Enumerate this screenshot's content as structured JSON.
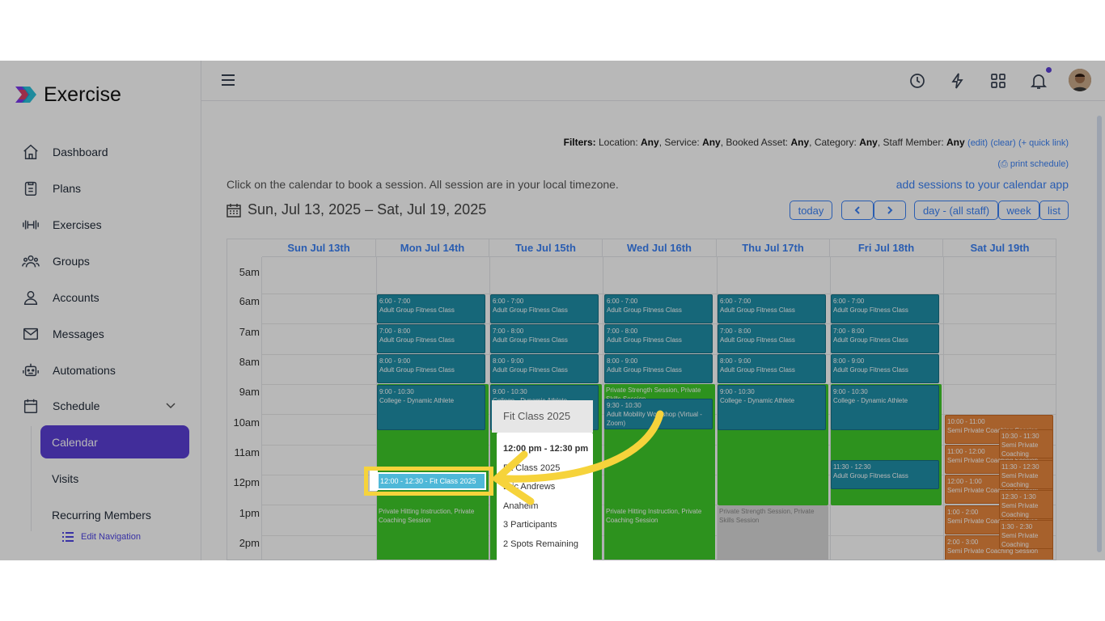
{
  "app": {
    "brand": "Exercise"
  },
  "sidebar": {
    "items": [
      {
        "label": "Dashboard",
        "icon": "home-icon"
      },
      {
        "label": "Plans",
        "icon": "clipboard-icon"
      },
      {
        "label": "Exercises",
        "icon": "dumbbell-icon"
      },
      {
        "label": "Groups",
        "icon": "users-icon"
      },
      {
        "label": "Accounts",
        "icon": "user-icon"
      },
      {
        "label": "Messages",
        "icon": "mail-icon"
      },
      {
        "label": "Automations",
        "icon": "robot-icon"
      },
      {
        "label": "Schedule",
        "icon": "calendar-icon"
      }
    ],
    "sub_items": [
      "Calendar",
      "Visits",
      "Recurring Members"
    ],
    "edit_navigation": "Edit Navigation"
  },
  "filters": {
    "label": "Filters:",
    "text_location": "Location:",
    "location": "Any",
    "text_service": "Service:",
    "service": "Any",
    "text_asset": "Booked Asset:",
    "asset": "Any",
    "text_category": "Category:",
    "category": "Any",
    "text_staff": "Staff Member:",
    "staff": "Any",
    "edit": "(edit)",
    "clear": "(clear)",
    "quick_link": "(+ quick link)",
    "print": "(⎙ print schedule)"
  },
  "calendar": {
    "hint": "Click on the calendar to book a session. All session are in your local timezone.",
    "add_sessions": "add sessions to your calendar app",
    "range": "Sun, Jul 13, 2025 – Sat, Jul 19, 2025",
    "buttons": {
      "today": "today",
      "day": "day - (all staff)",
      "week": "week",
      "list": "list"
    },
    "days": [
      "Sun Jul 13th",
      "Mon Jul 14th",
      "Tue Jul 15th",
      "Wed Jul 16th",
      "Thu Jul 17th",
      "Fri Jul 18th",
      "Sat Jul 19th"
    ],
    "hours": [
      "5am",
      "6am",
      "7am",
      "8am",
      "9am",
      "10am",
      "11am",
      "12pm",
      "1pm",
      "2pm"
    ],
    "events": {
      "t600": "6:00 - 7:00",
      "t700": "7:00 - 8:00",
      "t800": "8:00 - 9:00",
      "t900": "9:00 - 10:30",
      "agf": "Adult Group Fitness Class",
      "cda": "College - Dynamic Athlete",
      "t930": "9:30 - 10:30",
      "amw": "Adult Mobility Workshop (Virtual - Zoom)",
      "pss": "Private Strength Session, Private Skills Session",
      "t1130": "11:30 - 12:30",
      "phi": "Private Hitting Instruction, Private Coaching Session",
      "pss2": "Private Strength Session, Private Skills Session",
      "t1000": "10:00 - 11:00",
      "t1030": "10:30 - 11:30",
      "t1100": "11:00 - 12:00",
      "t1130b": "11:30 - 12:30",
      "t1200": "12:00 - 1:00",
      "t1230": "12:30 - 1:30",
      "t100": "1:00 - 2:00",
      "t130": "1:30 - 2:30",
      "t200": "2:00 - 3:00",
      "spc": "Semi Private Coaching Session",
      "spc2": "Semi Private Coaching"
    },
    "highlighted": "12:00 - 12:30 - Fit Class 2025",
    "popup": {
      "title": "Fit Class 2025",
      "time": "12:00 pm - 12:30 pm",
      "name": "Fit Class 2025",
      "coach": "Eric Andrews",
      "location": "Anaheim",
      "participants": "3 Participants",
      "spots": "2 Spots Remaining"
    }
  },
  "colors": {
    "accent": "#5b3fd6",
    "link": "#3b82f6",
    "teal": "#1f8fa8",
    "green": "#3fcb2a",
    "orange": "#e8873e",
    "highlight": "#f6d33b"
  }
}
